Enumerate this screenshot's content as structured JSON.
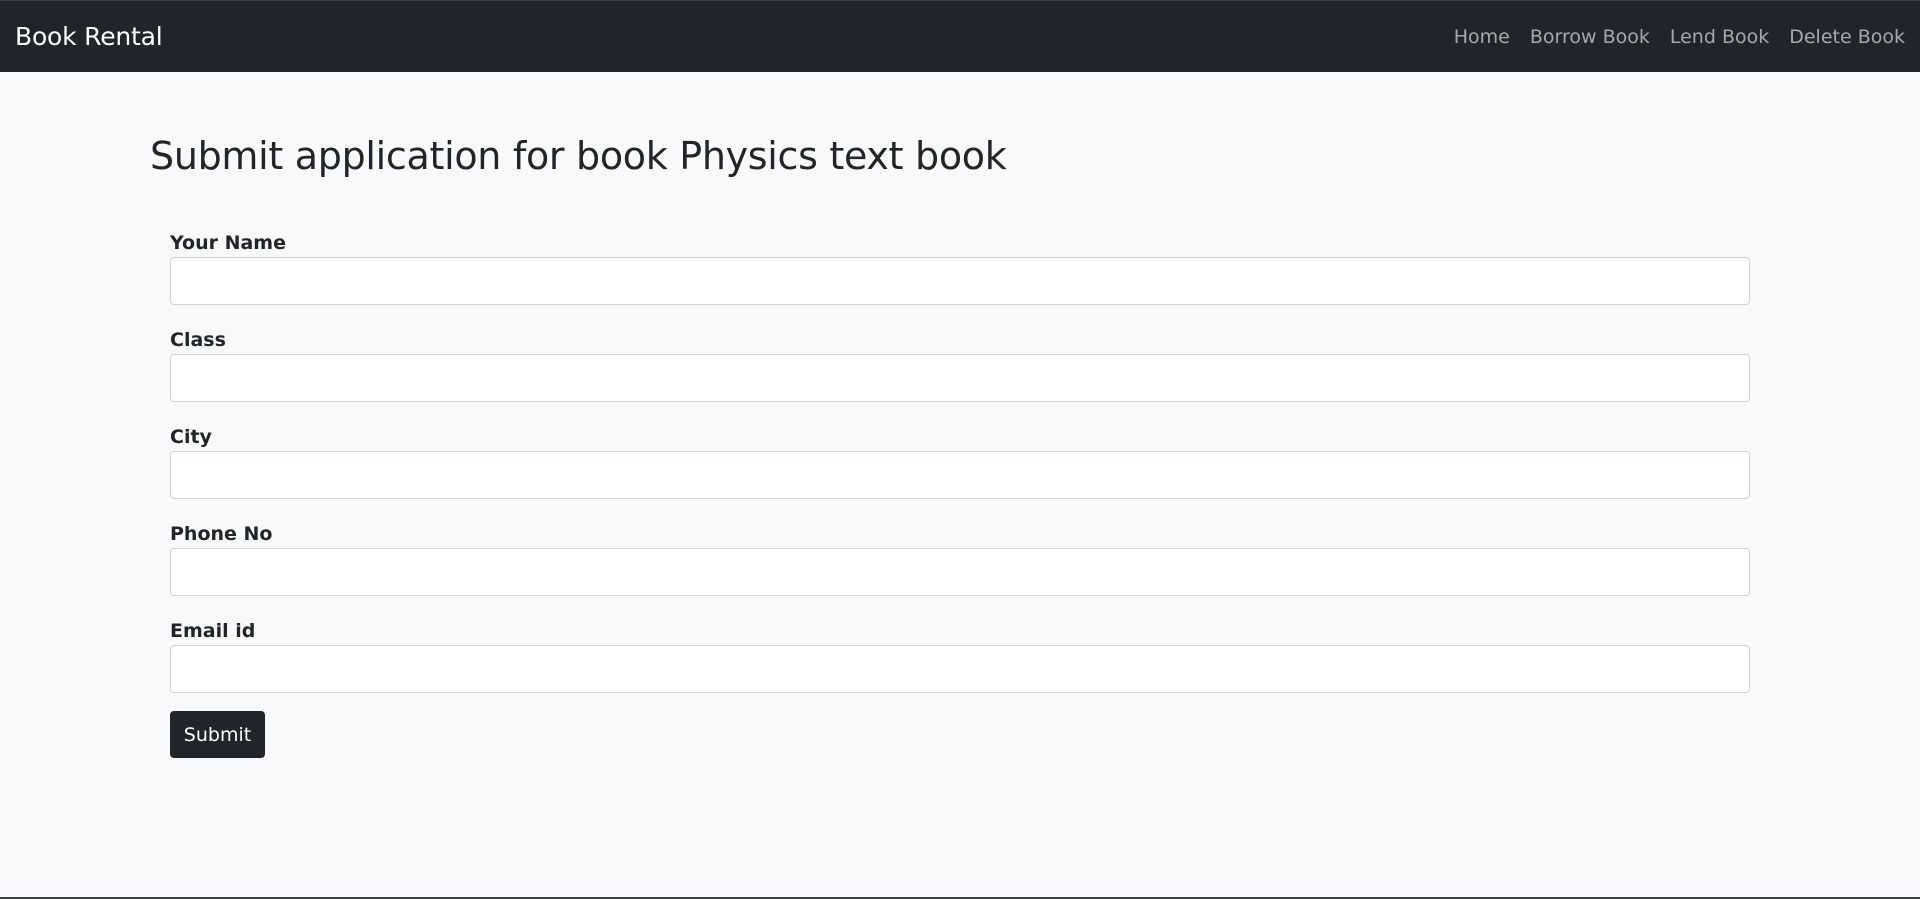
{
  "navbar": {
    "brand": "Book Rental",
    "links": [
      "Home",
      "Borrow Book",
      "Lend Book",
      "Delete Book"
    ]
  },
  "page": {
    "title": "Submit application for book Physics text book"
  },
  "form": {
    "fields": [
      {
        "label": "Your Name",
        "value": "",
        "placeholder": ""
      },
      {
        "label": "Class",
        "value": "",
        "placeholder": ""
      },
      {
        "label": "City",
        "value": "",
        "placeholder": ""
      },
      {
        "label": "Phone No",
        "value": "",
        "placeholder": ""
      },
      {
        "label": "Email id",
        "value": "",
        "placeholder": ""
      }
    ],
    "submit_label": "Submit"
  },
  "colors": {
    "navbar_bg": "#212529",
    "page_bg": "#f8f9fa",
    "button_bg": "#212529"
  }
}
